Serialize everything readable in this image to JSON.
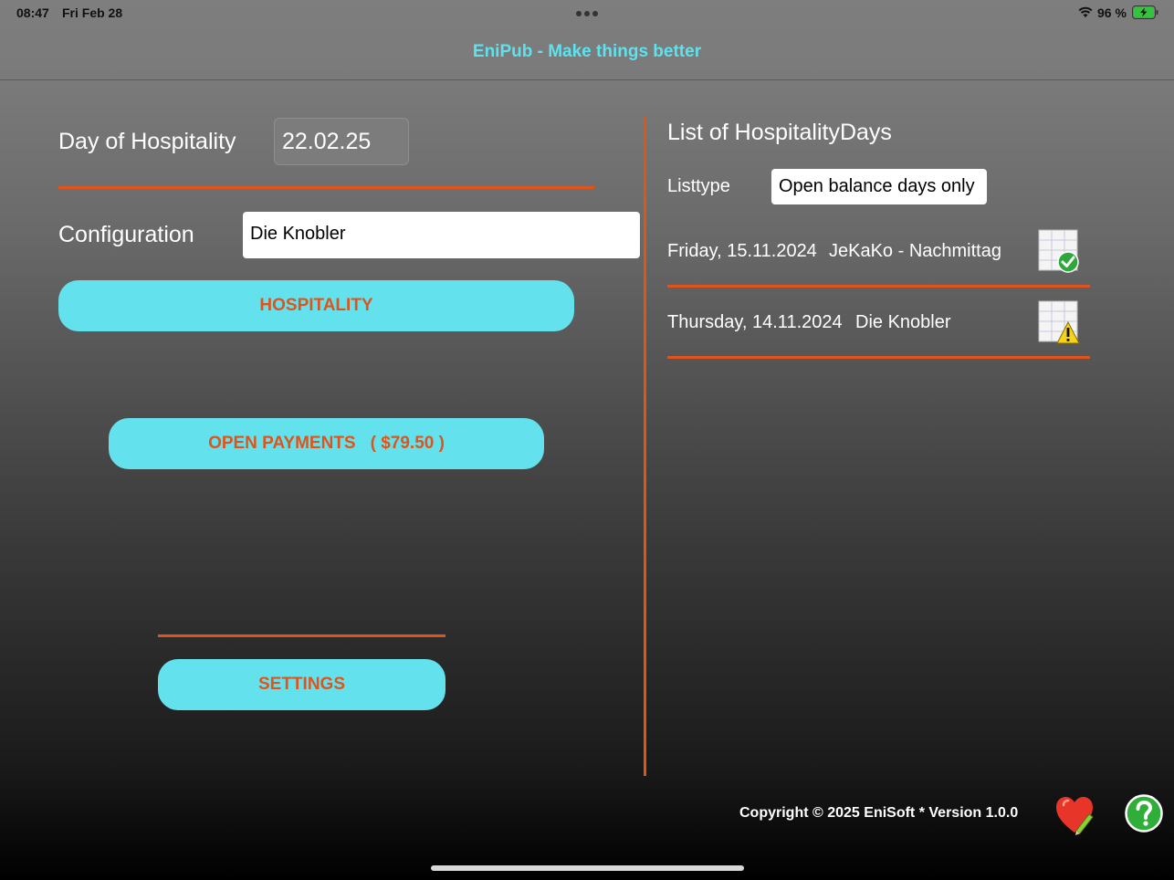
{
  "status_bar": {
    "time": "08:47",
    "date": "Fri Feb 28",
    "battery_percent": "96 %",
    "wifi_icon": "wifi-icon",
    "battery_icon": "battery-charging-icon"
  },
  "app": {
    "title": "EniPub - Make things better",
    "title_color": "#5de2ee",
    "accent_color": "#e0541c",
    "button_color": "#63e2ee"
  },
  "left": {
    "day_label": "Day of Hospitality",
    "day_value": "22.02.25",
    "config_label": "Configuration",
    "config_value": "Die Knobler",
    "hospitality_button": "HOSPITALITY",
    "open_payments_button": "OPEN PAYMENTS",
    "open_payments_amount": "( $79.50 )",
    "settings_button": "SETTINGS"
  },
  "right": {
    "list_title": "List of HospitalityDays",
    "listtype_label": "Listtype",
    "listtype_value": "Open balance days only",
    "days": [
      {
        "date": "Friday, 15.11.2024",
        "configuration": "JeKaKo - Nachmittag",
        "status_icon": "grid-check-icon"
      },
      {
        "date": "Thursday, 14.11.2024",
        "configuration": "Die Knobler",
        "status_icon": "grid-warning-icon"
      }
    ]
  },
  "footer": {
    "copyright": "Copyright © 2025 EniSoft  *  Version  1.0.0",
    "heart_icon": "heart-edit-icon",
    "help_icon": "help-icon"
  }
}
